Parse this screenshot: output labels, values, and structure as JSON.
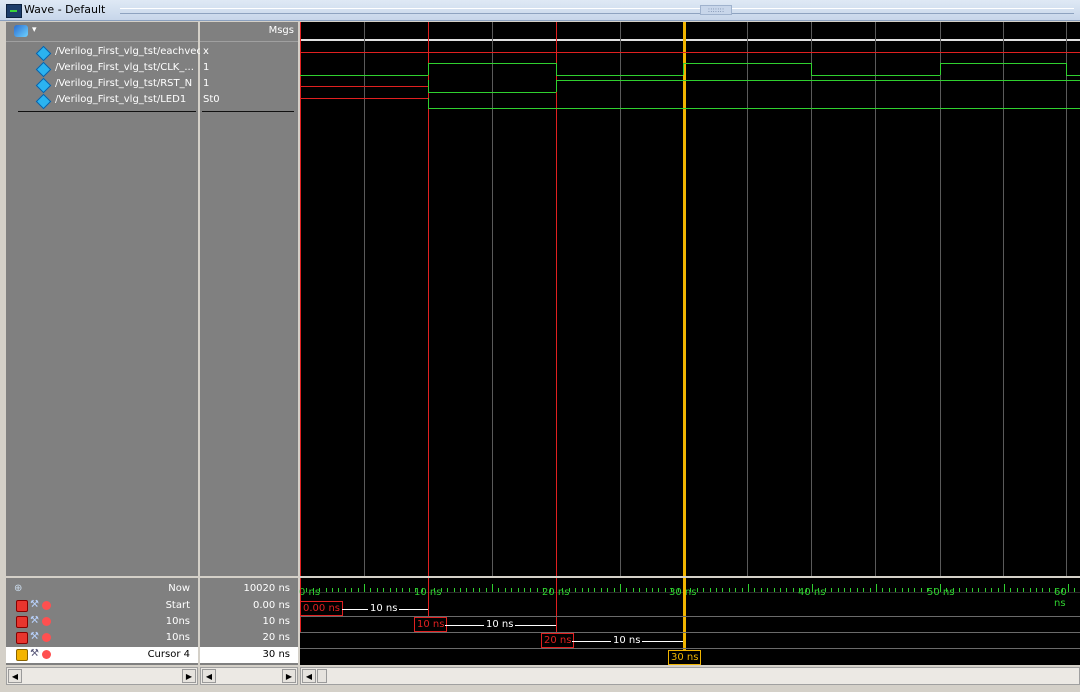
{
  "window": {
    "title": "Wave - Default"
  },
  "header": {
    "msgs_label": "Msgs"
  },
  "signals": [
    {
      "name": "/Verilog_First_vlg_tst/eachvec",
      "value": "x"
    },
    {
      "name": "/Verilog_First_vlg_tst/CLK_...",
      "value": "1"
    },
    {
      "name": "/Verilog_First_vlg_tst/RST_N",
      "value": "1"
    },
    {
      "name": "/Verilog_First_vlg_tst/LED1",
      "value": "St0"
    }
  ],
  "bottom": {
    "now": {
      "label": "Now",
      "value": "10020 ns"
    },
    "cursors": [
      {
        "label": "Start",
        "value": "0.00 ns",
        "locked": true
      },
      {
        "label": "10ns",
        "value": "10 ns",
        "locked": true
      },
      {
        "label": "10ns",
        "value": "20 ns",
        "locked": true
      },
      {
        "label": "Cursor 4",
        "value": "30 ns",
        "locked": false
      }
    ]
  },
  "timeline": {
    "tick_labels": [
      "0 ns",
      "10 ns",
      "20 ns",
      "30 ns",
      "40 ns",
      "50 ns",
      "60 ns"
    ],
    "cursor_markers": [
      "0.00 ns",
      "10 ns",
      "20 ns",
      "30 ns"
    ],
    "span_labels": [
      "10 ns",
      "10 ns",
      "10 ns"
    ]
  },
  "colors": {
    "wave_green": "#2fd02f",
    "cursor_red": "#e02020",
    "cursor_active": "#f0b400"
  },
  "icons": [
    "globe-icon",
    "dropdown-arrow-icon",
    "signal-diamond-icon",
    "lock-icon",
    "wrench-icon",
    "remove-icon",
    "add-cursor-icon"
  ]
}
